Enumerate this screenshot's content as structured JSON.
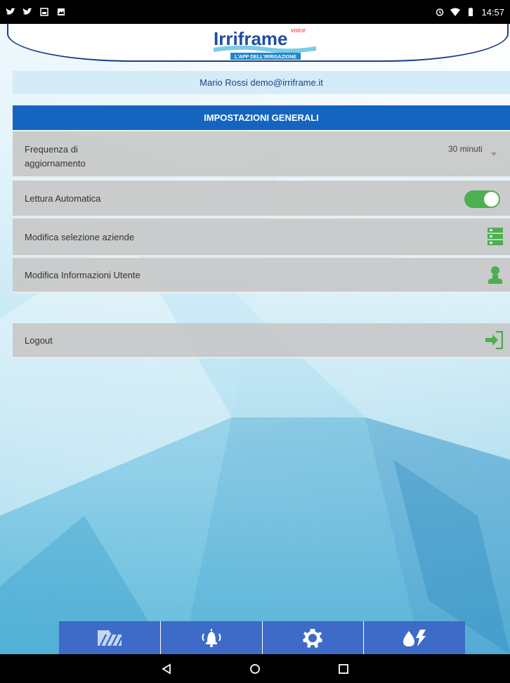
{
  "status_bar": {
    "time": "14:57"
  },
  "header": {
    "logo_text": "Irriframe",
    "logo_badge": "voice",
    "logo_tagline": "L'APP DELL'IRRIGAZIONE"
  },
  "user": {
    "info": "Mario Rossi demo@irriframe.it"
  },
  "settings": {
    "section_title": "IMPOSTAZIONI GENERALI",
    "frequency_label": "Frequenza di aggiornamento",
    "frequency_value": "30 minuti",
    "auto_read_label": "Lettura Automatica",
    "auto_read_on": true,
    "edit_companies_label": "Modifica selezione aziende",
    "edit_user_label": "Modifica Informazioni Utente",
    "logout_label": "Logout"
  },
  "bottom_nav": {
    "items": [
      {
        "icon": "field-irrigation-icon"
      },
      {
        "icon": "alarm-bell-icon"
      },
      {
        "icon": "settings-gear-icon"
      },
      {
        "icon": "water-drop-bolt-icon"
      }
    ]
  },
  "colors": {
    "primary": "#1565c0",
    "nav": "#3e6bc8",
    "toggle_on": "#4caf50",
    "icon_green": "#4caf50",
    "user_bar_bg": "#d4ecf8"
  }
}
